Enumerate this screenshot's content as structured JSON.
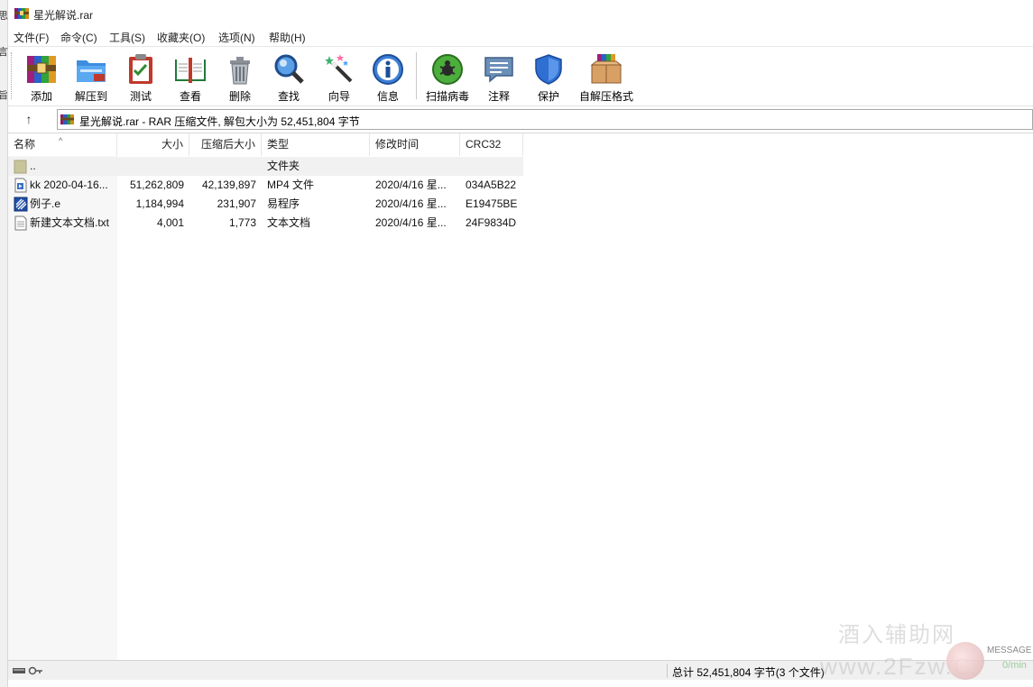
{
  "window": {
    "title": "星光解说.rar"
  },
  "behind": {
    "chars": [
      "思",
      "言",
      "旨"
    ]
  },
  "menu": [
    "文件(F)",
    "命令(C)",
    "工具(S)",
    "收藏夹(O)",
    "选项(N)",
    "帮助(H)"
  ],
  "toolbar": {
    "buttons": [
      {
        "label": "添加",
        "icon": "add-archive-icon"
      },
      {
        "label": "解压到",
        "icon": "extract-to-folder-icon"
      },
      {
        "label": "测试",
        "icon": "test-clipboard-icon"
      },
      {
        "label": "查看",
        "icon": "view-book-icon"
      },
      {
        "label": "删除",
        "icon": "trash-icon"
      },
      {
        "label": "查找",
        "icon": "magnifier-icon"
      },
      {
        "label": "向导",
        "icon": "wizard-wand-icon"
      },
      {
        "label": "信息",
        "icon": "info-icon"
      },
      {
        "label": "扫描病毒",
        "icon": "virus-scan-icon"
      },
      {
        "label": "注释",
        "icon": "comment-icon"
      },
      {
        "label": "保护",
        "icon": "shield-icon"
      },
      {
        "label": "自解压格式",
        "icon": "sfx-box-icon"
      }
    ]
  },
  "address": {
    "up_icon": "↑",
    "path": "星光解说.rar - RAR 压缩文件, 解包大小为 52,451,804 字节"
  },
  "list": {
    "sort_glyph": "^",
    "columns": [
      "名称",
      "大小",
      "压缩后大小",
      "类型",
      "修改时间",
      "CRC32"
    ],
    "rows": [
      {
        "name": "..",
        "size": "",
        "packed": "",
        "type": "文件夹",
        "modified": "",
        "crc": "",
        "icon": "folder-icon"
      },
      {
        "name": "kk 2020-04-16...",
        "size": "51,262,809",
        "packed": "42,139,897",
        "type": "MP4 文件",
        "modified": "2020/4/16 星...",
        "crc": "034A5B22",
        "icon": "video-file-icon"
      },
      {
        "name": "例子.e",
        "size": "1,184,994",
        "packed": "231,907",
        "type": "易程序",
        "modified": "2020/4/16 星...",
        "crc": "E19475BE",
        "icon": "e-program-icon"
      },
      {
        "name": "新建文本文档.txt",
        "size": "4,001",
        "packed": "1,773",
        "type": "文本文档",
        "modified": "2020/4/16 星...",
        "crc": "24F9834D",
        "icon": "text-file-icon"
      }
    ]
  },
  "status": {
    "text": "总计 52,451,804 字节(3 个文件)"
  },
  "overlay": {
    "watermark_cn": "酒入辅助网",
    "watermark_url": "www.2Fzw.C",
    "message": "MESSAGE",
    "message_sub": "0/min"
  }
}
